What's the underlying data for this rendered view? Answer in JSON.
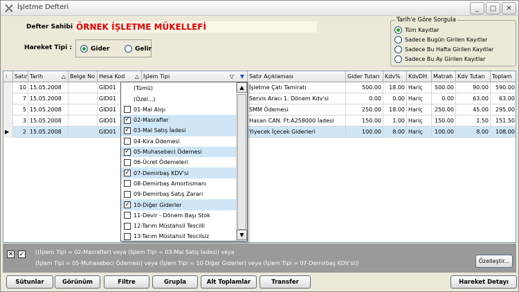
{
  "window": {
    "title": "İşletme Defteri",
    "minimize": "_",
    "maximize": "□",
    "close": "✕"
  },
  "header": {
    "owner_label": "Defter Sahibi :",
    "owner_value": "ÖRNEK İŞLETME MÜKELLEFİ",
    "movement_label": "Hareket Tipi :",
    "movement_options": [
      {
        "label": "Gider",
        "selected": true
      },
      {
        "label": "Gelir",
        "selected": false
      }
    ]
  },
  "date_query": {
    "legend": "Tarih'e Göre Sorgula",
    "options": [
      {
        "label": "Tüm Kayıtlar",
        "selected": true
      },
      {
        "label": "Sadece Bugün Girilen Kayıtlar",
        "selected": false
      },
      {
        "label": "Sadece Bu Hafta Girilen Kayıtlar",
        "selected": false
      },
      {
        "label": "Sadece Bu Ay Girilen Kayıtlar",
        "selected": false
      }
    ]
  },
  "grid": {
    "columns": [
      "Satır",
      "Tarih",
      "Belge No",
      "Hesa Kod",
      "İşlem Tipi",
      "Satır Açıklaması",
      "Gider Tutarı",
      "Kdv%",
      "KdvDH",
      "Matrah",
      "Kdv Tutarı",
      "Toplam"
    ],
    "rows": [
      {
        "satir": "10",
        "tarih": "15.05.2008",
        "belge": "",
        "hesap": "GID01",
        "aciklama": "İşletme Çatı Tamiratı",
        "gider": "500.00",
        "kdv": "18.00",
        "kdvdh": "Hariç",
        "matrah": "500.00",
        "kdvtutar": "90.00",
        "toplam": "590.00"
      },
      {
        "satir": "7",
        "tarih": "15.05.2008",
        "belge": "",
        "hesap": "GID01",
        "aciklama": "Servis Aracı 1. Dönem Kdv'si",
        "gider": "0.00",
        "kdv": "0.00",
        "kdvdh": "Hariç",
        "matrah": "0.00",
        "kdvtutar": "63.00",
        "toplam": "63.00"
      },
      {
        "satir": "5",
        "tarih": "15.05.2008",
        "belge": "",
        "hesap": "GID01",
        "aciklama": "SMM Ödemesi",
        "gider": "250.00",
        "kdv": "18.00",
        "kdvdh": "Hariç",
        "matrah": "250.00",
        "kdvtutar": "45.00",
        "toplam": "295.00"
      },
      {
        "satir": "3",
        "tarih": "15.05.2008",
        "belge": "",
        "hesap": "GID01",
        "aciklama": "Hasan CAN. Ft:A258000 İadesi",
        "gider": "150.00",
        "kdv": "1.00",
        "kdvdh": "Hariç",
        "matrah": "150.00",
        "kdvtutar": "1.50",
        "toplam": "151.50"
      },
      {
        "satir": "2",
        "tarih": "15.05.2008",
        "belge": "",
        "hesap": "GID01",
        "aciklama": "Yiyecek İçecek Giderleri",
        "gider": "100.00",
        "kdv": "8.00",
        "kdvdh": "Hariç",
        "matrah": "100.00",
        "kdvtutar": "8.00",
        "toplam": "108.00"
      }
    ]
  },
  "filter_dropdown": {
    "items": [
      {
        "label": "(Tümü)",
        "checkbox": false,
        "checked": false
      },
      {
        "label": "(Özel...)",
        "checkbox": false,
        "checked": false
      },
      {
        "label": "01-Mal Alışı",
        "checkbox": true,
        "checked": false
      },
      {
        "label": "02-Masraflar",
        "checkbox": true,
        "checked": true
      },
      {
        "label": "03-Mal Satış İadesi",
        "checkbox": true,
        "checked": true
      },
      {
        "label": "04-Kira Ödemesi",
        "checkbox": true,
        "checked": false
      },
      {
        "label": "05-Muhasebeci Ödemesi",
        "checkbox": true,
        "checked": true
      },
      {
        "label": "06-Ücret Ödemeleri",
        "checkbox": true,
        "checked": false
      },
      {
        "label": "07-Demirbaş KDV'si",
        "checkbox": true,
        "checked": true
      },
      {
        "label": "08-Demirbaş Amortismanı",
        "checkbox": true,
        "checked": false
      },
      {
        "label": "09-Demirbaş Satış Zararı",
        "checkbox": true,
        "checked": false
      },
      {
        "label": "10-Diğer Giderler",
        "checkbox": true,
        "checked": true
      },
      {
        "label": "11-Devir - Dönem Başı Stok",
        "checkbox": true,
        "checked": false
      },
      {
        "label": "12-Tarım Müstahsil Tescilli",
        "checkbox": true,
        "checked": false
      },
      {
        "label": "13-Tarım Müstahsil Tescilsiz",
        "checkbox": true,
        "checked": false
      }
    ]
  },
  "filter_bar": {
    "line1": "((İşlem Tipi = 02-Masraflar) veya (İşlem Tipi = 03-Mal Satış İadesi) veya",
    "line2": "(İşlem Tipi = 05-Muhasebeci Ödemesi) veya (İşlem Tipi = 10-Diğer Giderler) veya (İşlem Tipi = 07-Demirbaş KDV'si))",
    "customize": "Özelleştir..."
  },
  "toolbar": {
    "buttons": [
      "Sütunlar",
      "Görünüm",
      "Filtre",
      "Grupla",
      "Alt Toplamlar",
      "Transfer"
    ],
    "detail": "Hareket Detayı"
  }
}
